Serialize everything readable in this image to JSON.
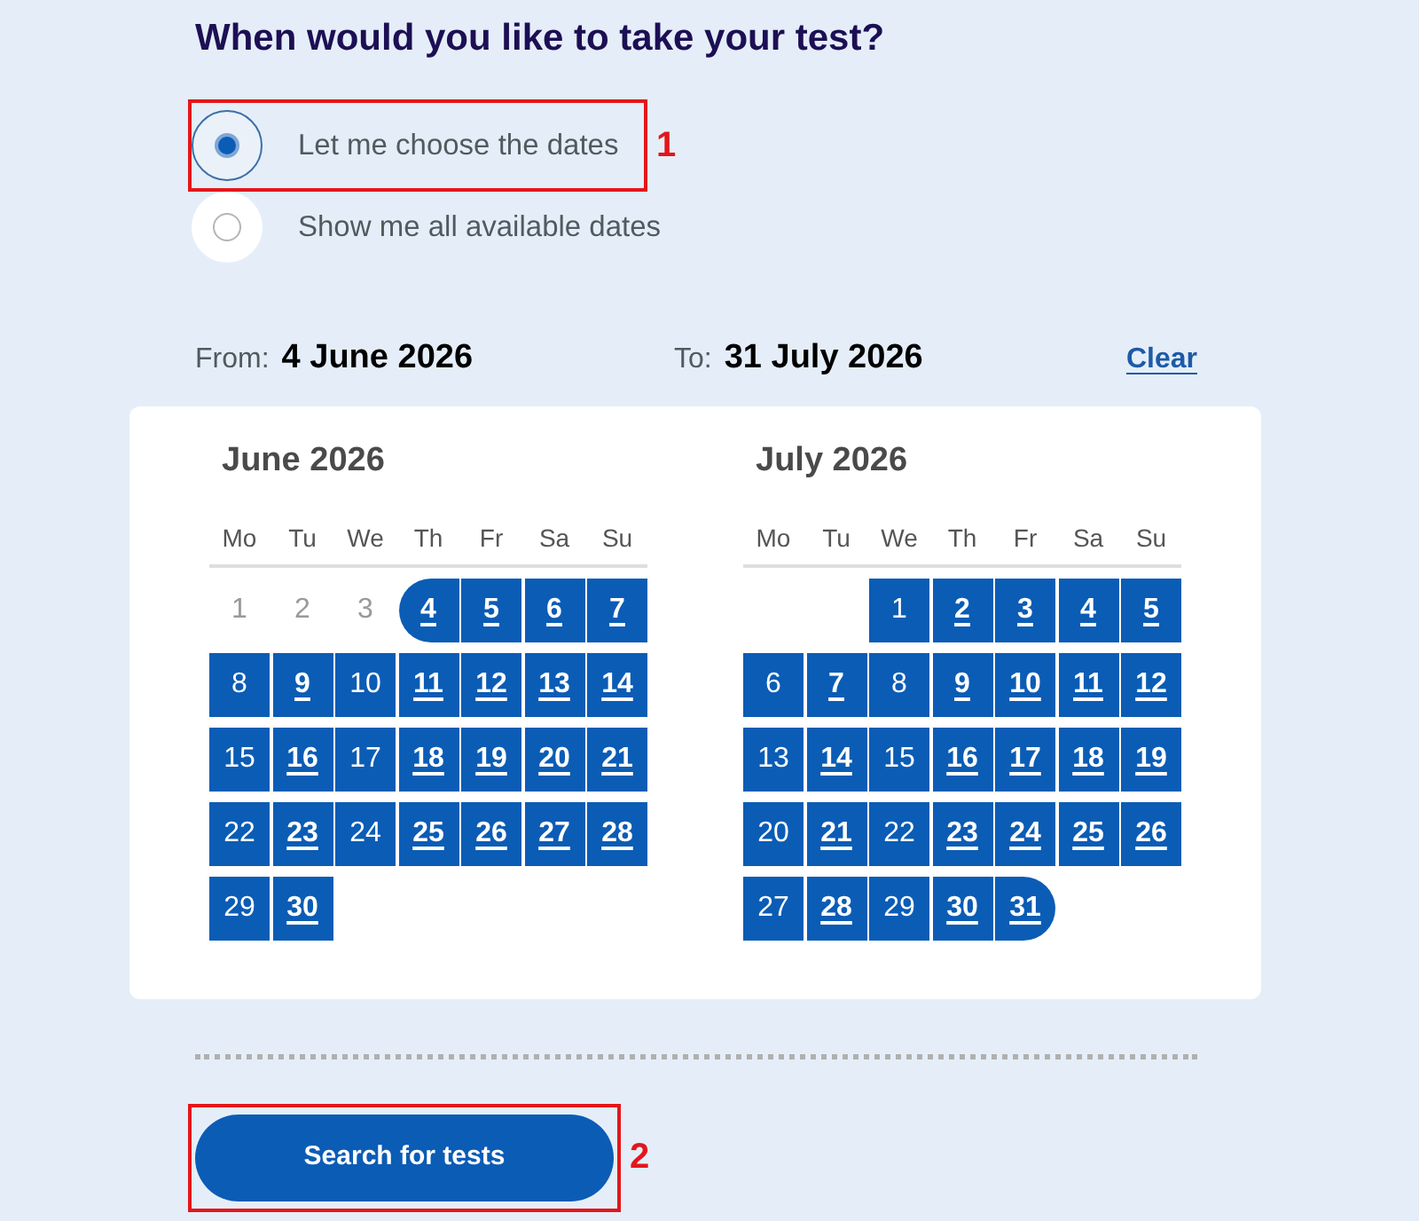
{
  "heading": "When would you like to take your test?",
  "date_options": [
    {
      "label": "Let me choose the dates",
      "selected": true,
      "annotation": "1"
    },
    {
      "label": "Show me all available dates",
      "selected": false
    }
  ],
  "range": {
    "from_label": "From:",
    "from_value": "4 June 2026",
    "to_label": "To:",
    "to_value": "31 July 2026",
    "clear_link": "Clear"
  },
  "months": [
    {
      "title": "June 2026",
      "weekdays": [
        "Mo",
        "Tu",
        "We",
        "Th",
        "Fr",
        "Sa",
        "Su"
      ],
      "weeks": [
        [
          {
            "day": "1",
            "kind": "outside",
            "available": false
          },
          {
            "day": "2",
            "kind": "outside",
            "available": false
          },
          {
            "day": "3",
            "kind": "outside",
            "available": false
          },
          {
            "day": "4",
            "kind": "start",
            "available": true
          },
          {
            "day": "5",
            "kind": "inside",
            "available": true
          },
          {
            "day": "6",
            "kind": "inside",
            "available": true
          },
          {
            "day": "7",
            "kind": "inside",
            "available": true
          }
        ],
        [
          {
            "day": "8",
            "kind": "inside",
            "available": false
          },
          {
            "day": "9",
            "kind": "inside",
            "available": true
          },
          {
            "day": "10",
            "kind": "inside",
            "available": false
          },
          {
            "day": "11",
            "kind": "inside",
            "available": true
          },
          {
            "day": "12",
            "kind": "inside",
            "available": true
          },
          {
            "day": "13",
            "kind": "inside",
            "available": true
          },
          {
            "day": "14",
            "kind": "inside",
            "available": true
          }
        ],
        [
          {
            "day": "15",
            "kind": "inside",
            "available": false
          },
          {
            "day": "16",
            "kind": "inside",
            "available": true
          },
          {
            "day": "17",
            "kind": "inside",
            "available": false
          },
          {
            "day": "18",
            "kind": "inside",
            "available": true
          },
          {
            "day": "19",
            "kind": "inside",
            "available": true
          },
          {
            "day": "20",
            "kind": "inside",
            "available": true
          },
          {
            "day": "21",
            "kind": "inside",
            "available": true
          }
        ],
        [
          {
            "day": "22",
            "kind": "inside",
            "available": false
          },
          {
            "day": "23",
            "kind": "inside",
            "available": true
          },
          {
            "day": "24",
            "kind": "inside",
            "available": false
          },
          {
            "day": "25",
            "kind": "inside",
            "available": true
          },
          {
            "day": "26",
            "kind": "inside",
            "available": true
          },
          {
            "day": "27",
            "kind": "inside",
            "available": true
          },
          {
            "day": "28",
            "kind": "inside",
            "available": true
          }
        ],
        [
          {
            "day": "29",
            "kind": "inside",
            "available": false
          },
          {
            "day": "30",
            "kind": "inside",
            "available": true
          }
        ]
      ]
    },
    {
      "title": "July 2026",
      "weekdays": [
        "Mo",
        "Tu",
        "We",
        "Th",
        "Fr",
        "Sa",
        "Su"
      ],
      "weeks": [
        [
          {
            "kind": "blank"
          },
          {
            "kind": "blank"
          },
          {
            "day": "1",
            "kind": "inside",
            "available": false
          },
          {
            "day": "2",
            "kind": "inside",
            "available": true
          },
          {
            "day": "3",
            "kind": "inside",
            "available": true
          },
          {
            "day": "4",
            "kind": "inside",
            "available": true
          },
          {
            "day": "5",
            "kind": "inside",
            "available": true
          }
        ],
        [
          {
            "day": "6",
            "kind": "inside",
            "available": false
          },
          {
            "day": "7",
            "kind": "inside",
            "available": true
          },
          {
            "day": "8",
            "kind": "inside",
            "available": false
          },
          {
            "day": "9",
            "kind": "inside",
            "available": true
          },
          {
            "day": "10",
            "kind": "inside",
            "available": true
          },
          {
            "day": "11",
            "kind": "inside",
            "available": true
          },
          {
            "day": "12",
            "kind": "inside",
            "available": true
          }
        ],
        [
          {
            "day": "13",
            "kind": "inside",
            "available": false
          },
          {
            "day": "14",
            "kind": "inside",
            "available": true
          },
          {
            "day": "15",
            "kind": "inside",
            "available": false
          },
          {
            "day": "16",
            "kind": "inside",
            "available": true
          },
          {
            "day": "17",
            "kind": "inside",
            "available": true
          },
          {
            "day": "18",
            "kind": "inside",
            "available": true
          },
          {
            "day": "19",
            "kind": "inside",
            "available": true
          }
        ],
        [
          {
            "day": "20",
            "kind": "inside",
            "available": false
          },
          {
            "day": "21",
            "kind": "inside",
            "available": true
          },
          {
            "day": "22",
            "kind": "inside",
            "available": false
          },
          {
            "day": "23",
            "kind": "inside",
            "available": true
          },
          {
            "day": "24",
            "kind": "inside",
            "available": true
          },
          {
            "day": "25",
            "kind": "inside",
            "available": true
          },
          {
            "day": "26",
            "kind": "inside",
            "available": true
          }
        ],
        [
          {
            "day": "27",
            "kind": "inside",
            "available": false
          },
          {
            "day": "28",
            "kind": "inside",
            "available": true
          },
          {
            "day": "29",
            "kind": "inside",
            "available": false
          },
          {
            "day": "30",
            "kind": "inside",
            "available": true
          },
          {
            "day": "31",
            "kind": "end",
            "available": true
          }
        ]
      ]
    }
  ],
  "search_button": {
    "label": "Search for tests",
    "annotation": "2"
  }
}
